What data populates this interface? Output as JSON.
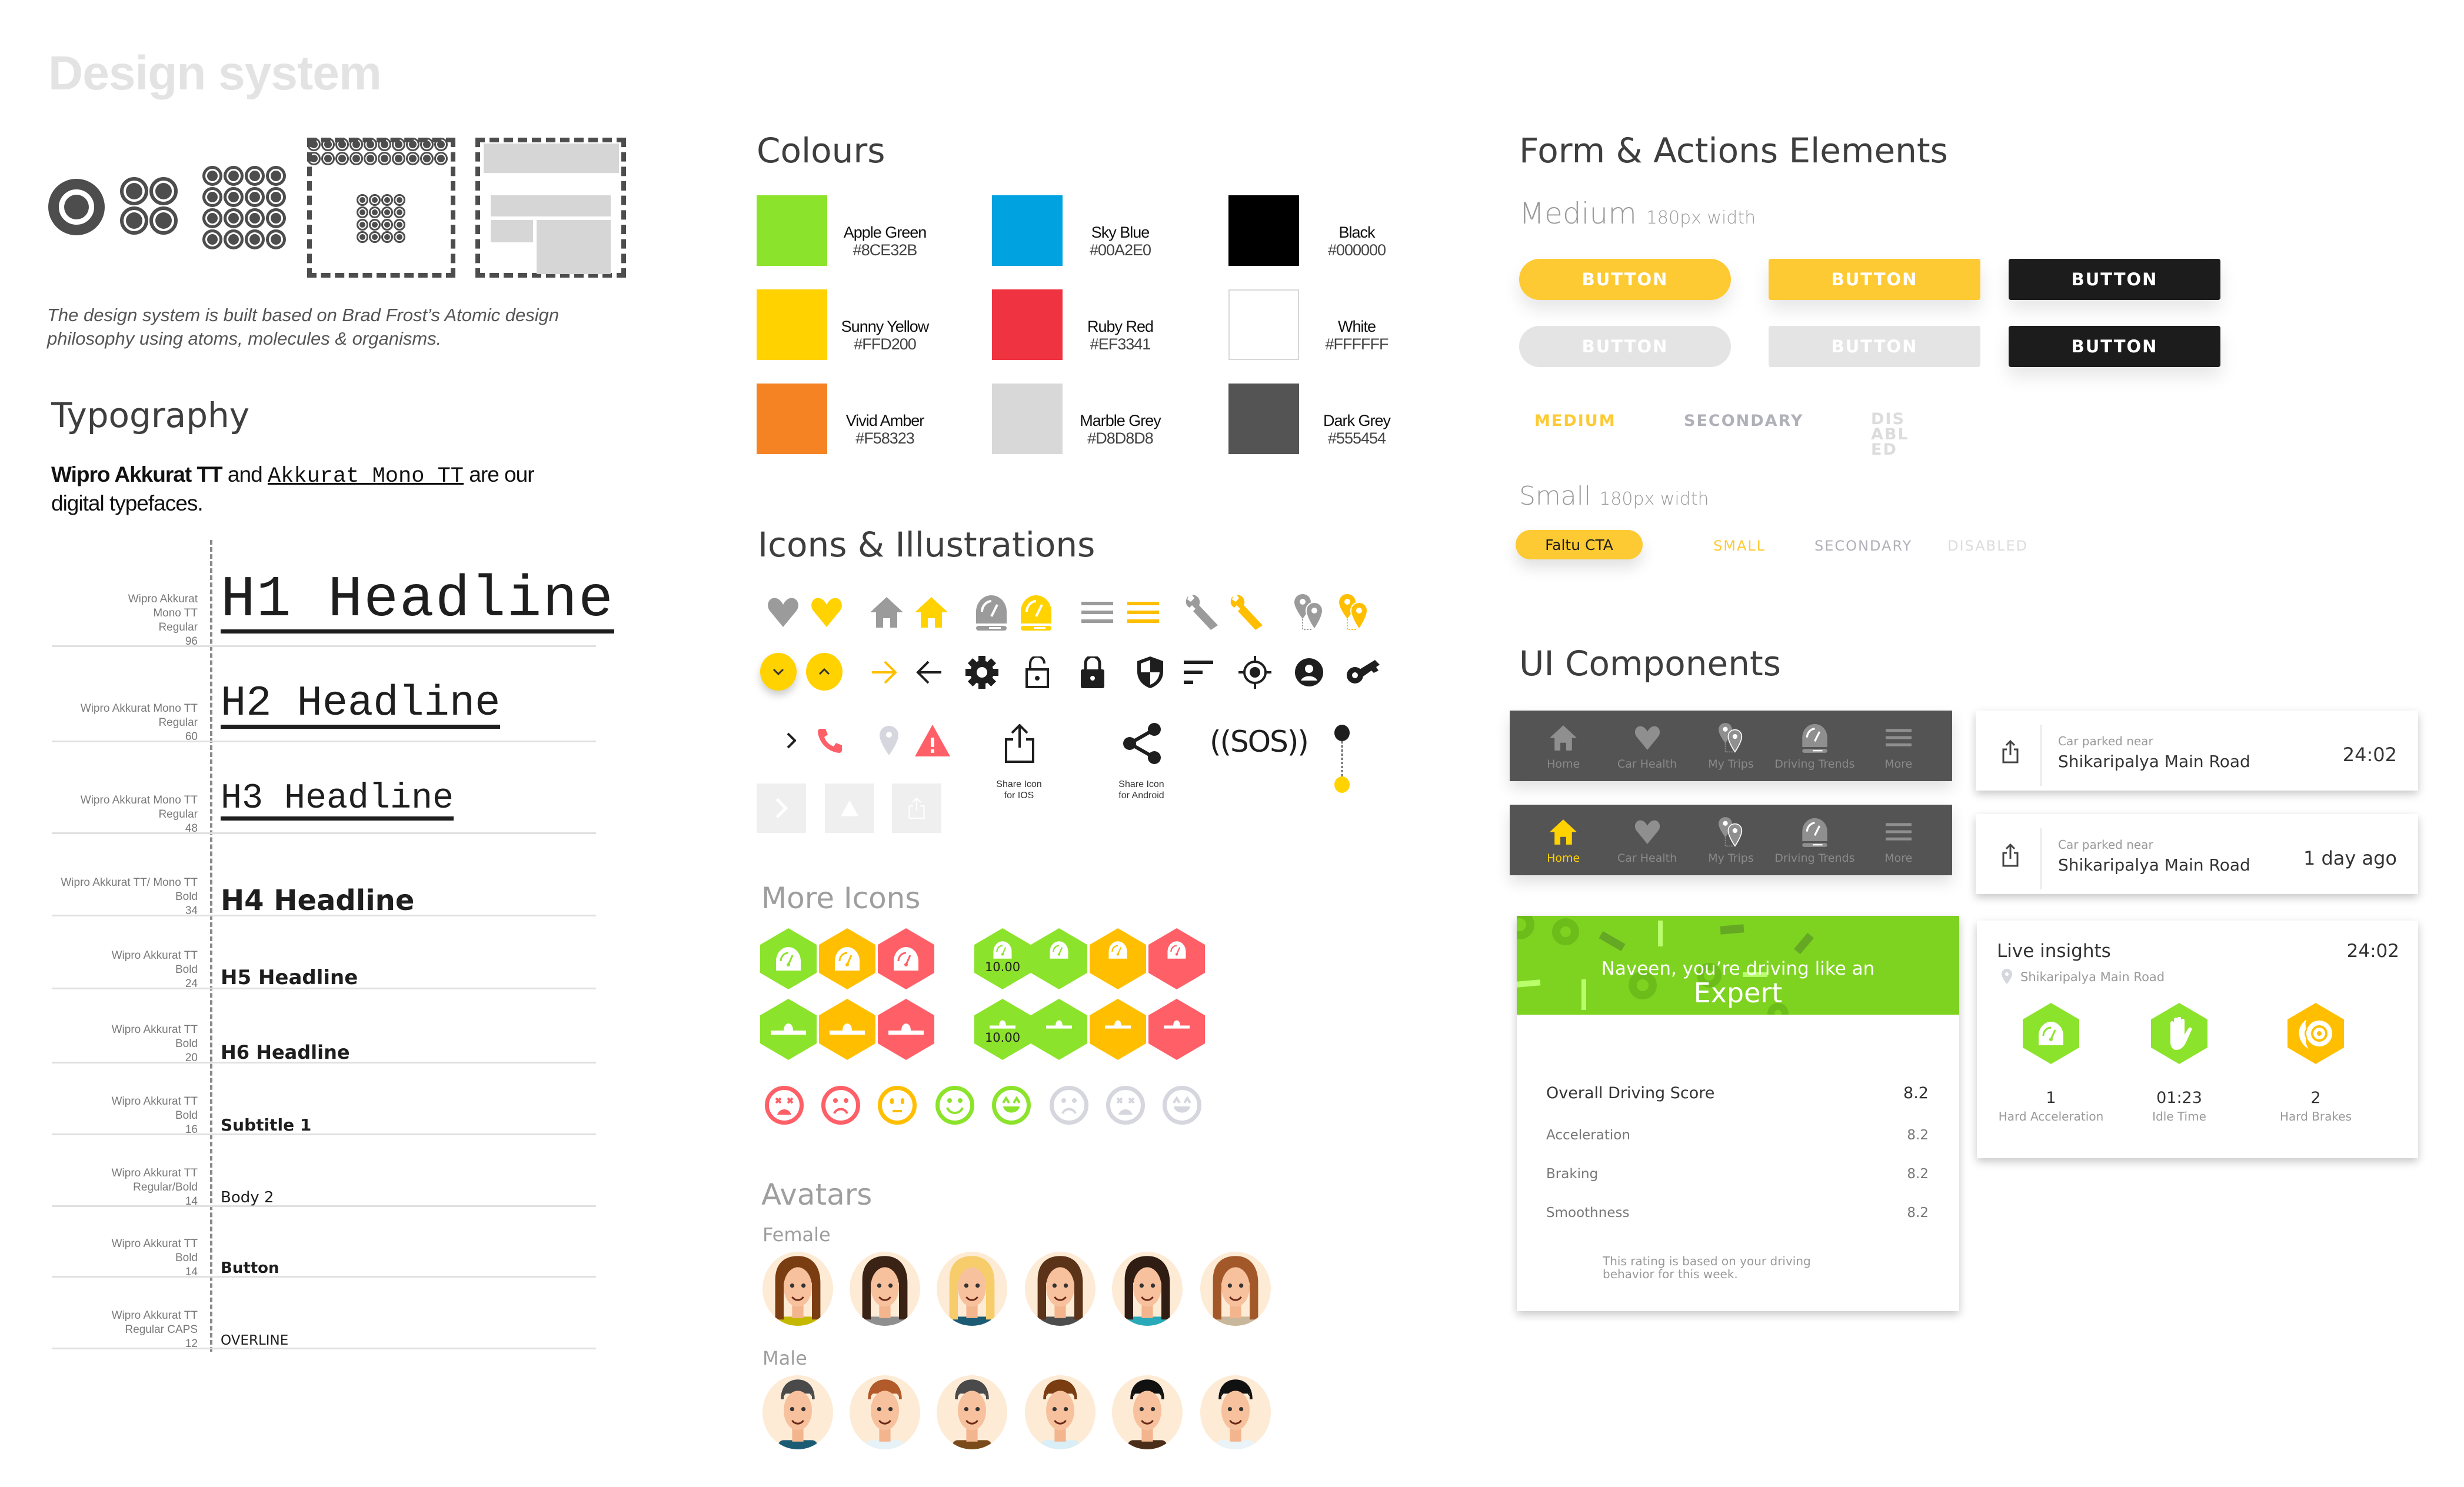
{
  "page": {
    "title": "Design system",
    "intro": "The design system is built based on Brad Frost’s Atomic design philosophy using atoms, molecules & organisms."
  },
  "typography": {
    "heading": "Typography",
    "intro_bold": "Wipro Akkurat TT",
    "intro_and": " and ",
    "intro_mono": "Akkurat Mono TT",
    "intro_rest": " are our digital typefaces.",
    "rows": [
      {
        "meta": [
          "Wipro Akkurat",
          "Mono TT",
          "Regular",
          "96"
        ],
        "sample": "H1 Headline"
      },
      {
        "meta": [
          "Wipro Akkurat Mono TT",
          "Regular",
          "60"
        ],
        "sample": "H2 Headline"
      },
      {
        "meta": [
          "Wipro Akkurat Mono TT",
          "Regular",
          "48"
        ],
        "sample": "H3 Headline"
      },
      {
        "meta": [
          "Wipro Akkurat TT/ Mono TT",
          "Bold",
          "34"
        ],
        "sample": "H4 Headline"
      },
      {
        "meta": [
          "Wipro Akkurat TT",
          "Bold",
          "24"
        ],
        "sample": "H5 Headline"
      },
      {
        "meta": [
          "Wipro Akkurat TT",
          "Bold",
          "20"
        ],
        "sample": "H6 Headline"
      },
      {
        "meta": [
          "Wipro Akkurat TT",
          "Bold",
          "16"
        ],
        "sample": "Subtitle 1"
      },
      {
        "meta": [
          "Wipro Akkurat TT",
          "Regular/Bold",
          "14"
        ],
        "sample": "Body 2"
      },
      {
        "meta": [
          "Wipro Akkurat TT",
          "Bold",
          "14"
        ],
        "sample": "Button"
      },
      {
        "meta": [
          "Wipro Akkurat TT",
          "Regular CAPS",
          "12"
        ],
        "sample": "OVERLINE"
      }
    ]
  },
  "colours": {
    "heading": "Colours",
    "swatches": [
      {
        "name": "Apple Green",
        "hex": "#8CE32B"
      },
      {
        "name": "Sky Blue",
        "hex": "#00A2E0"
      },
      {
        "name": "Black",
        "hex": "#000000"
      },
      {
        "name": "Sunny Yellow",
        "hex": "#FFD200"
      },
      {
        "name": "Ruby Red",
        "hex": "#EF3341"
      },
      {
        "name": "White",
        "hex": "#FFFFFF"
      },
      {
        "name": "Vivid Amber",
        "hex": "#F58323"
      },
      {
        "name": "Marble Grey",
        "hex": "#D8D8D8"
      },
      {
        "name": "Dark Grey",
        "hex": "#555454"
      }
    ]
  },
  "icons": {
    "heading": "Icons & Illustrations",
    "row1": [
      "heart-grey",
      "heart-yellow",
      "home-grey",
      "home-yellow",
      "speedometer-grey",
      "speedometer-yellow",
      "menu-grey",
      "menu-yellow",
      "wrench-grey",
      "wrench-yellow",
      "trips-pin-grey",
      "trips-pin-yellow"
    ],
    "row2": [
      "chevron-down-fab",
      "chevron-up-fab",
      "arrow-right",
      "arrow-left",
      "gear",
      "unlock",
      "lock",
      "shield",
      "sort",
      "gps-target",
      "account",
      "key"
    ],
    "row3": [
      "chevron-right",
      "phone",
      "location-pin",
      "warning"
    ],
    "share_ios_caption": "Share Icon for IOS",
    "share_android_caption": "Share Icon for Android",
    "sos_label": "((SOS))",
    "disabled": [
      "chevron-right",
      "warning",
      "share"
    ]
  },
  "more_icons": {
    "heading": "More Icons",
    "badge_value": "10.00",
    "colors": {
      "green": "#8CE32B",
      "amber": "#FFBF00",
      "red": "#FF5F67"
    }
  },
  "avatars": {
    "heading": "Avatars",
    "female_label": "Female",
    "male_label": "Male",
    "female_count": 6,
    "male_count": 6
  },
  "forms": {
    "heading": "Form & Actions Elements",
    "medium_label": "Medium",
    "medium_note": "180px width",
    "button_label": "BUTTON",
    "text_buttons": [
      "MEDIUM",
      "SECONDARY",
      "DISABLED"
    ],
    "small_label": "Small",
    "small_note": "180px width",
    "small_cta": "Faltu CTA",
    "small_text_buttons": [
      "SMALL",
      "SECONDARY",
      "DISABLED"
    ]
  },
  "ui": {
    "heading": "UI Components",
    "tabs": [
      "Home",
      "Car Health",
      "My Trips",
      "Driving Trends",
      "More"
    ],
    "parked_cards": [
      {
        "label": "Car parked near",
        "road": "Shikaripalya Main Road",
        "time": "24:02"
      },
      {
        "label": "Car parked near",
        "road": "Shikaripalya Main Road",
        "time": "1 day ago"
      }
    ],
    "score_card": {
      "line1": "Naveen, you’re driving like an",
      "line2": "Expert",
      "rows": [
        {
          "label": "Overall Driving Score",
          "value": "8.2"
        },
        {
          "label": "Acceleration",
          "value": "8.2"
        },
        {
          "label": "Braking",
          "value": "8.2"
        },
        {
          "label": "Smoothness",
          "value": "8.2"
        }
      ],
      "note": "This rating is based on your driving behavior for this week."
    },
    "live_insights": {
      "title": "Live insights",
      "time": "24:02",
      "location": "Shikaripalya Main Road",
      "stats": [
        {
          "value": "1",
          "label": "Hard Acceleration"
        },
        {
          "value": "01:23",
          "label": "Idle Time"
        },
        {
          "value": "2",
          "label": "Hard Brakes"
        }
      ]
    }
  }
}
